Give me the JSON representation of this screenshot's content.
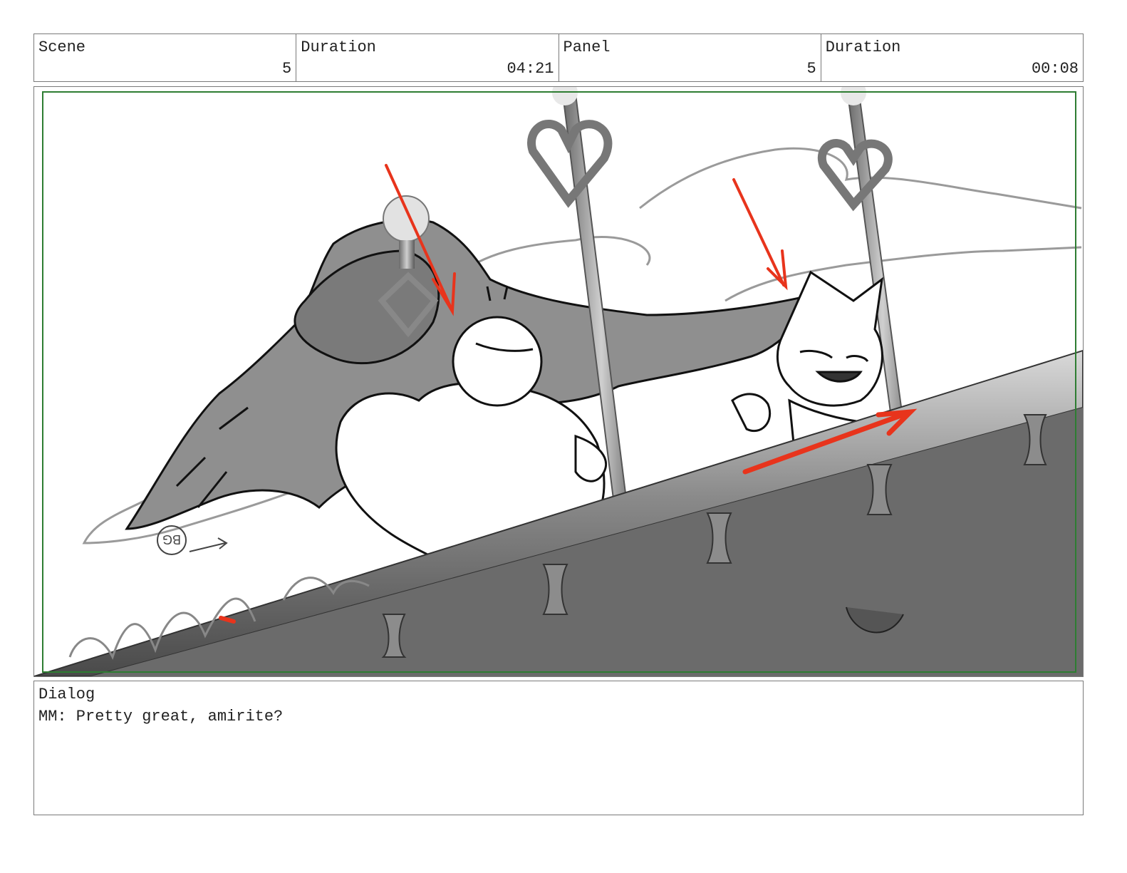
{
  "header": {
    "scene_label": "Scene",
    "scene_value": "5",
    "scene_duration_label": "Duration",
    "scene_duration_value": "04:21",
    "panel_label": "Panel",
    "panel_value": "5",
    "panel_duration_label": "Duration",
    "panel_duration_value": "00:08"
  },
  "frame": {
    "border_color": "#2e7d32",
    "arrow_color": "#e8341c",
    "bg_note": "BG"
  },
  "dialog": {
    "label": "Dialog",
    "text": "MM: Pretty great, amirite?"
  }
}
